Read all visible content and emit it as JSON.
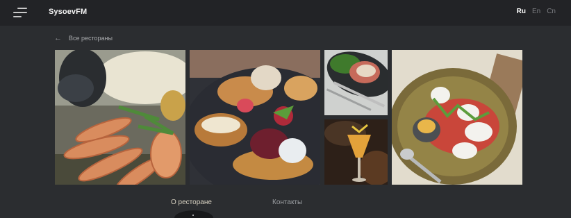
{
  "header": {
    "logo": "SysoevFM",
    "languages": [
      {
        "label": "Ru",
        "active": true
      },
      {
        "label": "En",
        "active": false
      },
      {
        "label": "Cn",
        "active": false
      }
    ]
  },
  "back_link": {
    "arrow_icon": "arrow-left-icon",
    "label": "Все рестораны"
  },
  "gallery": {
    "photos": [
      {
        "name": "seafood-platter-photo"
      },
      {
        "name": "tapas-toast-photo"
      },
      {
        "name": "herb-plate-photo"
      },
      {
        "name": "cocktail-photo"
      },
      {
        "name": "salad-plate-photo"
      }
    ]
  },
  "footer_nav": {
    "about": "О ресторане",
    "contacts": "Контакты"
  },
  "colors": {
    "background": "#2b2d30",
    "topbar": "#222326",
    "accent_link": "#d8d2c2"
  }
}
